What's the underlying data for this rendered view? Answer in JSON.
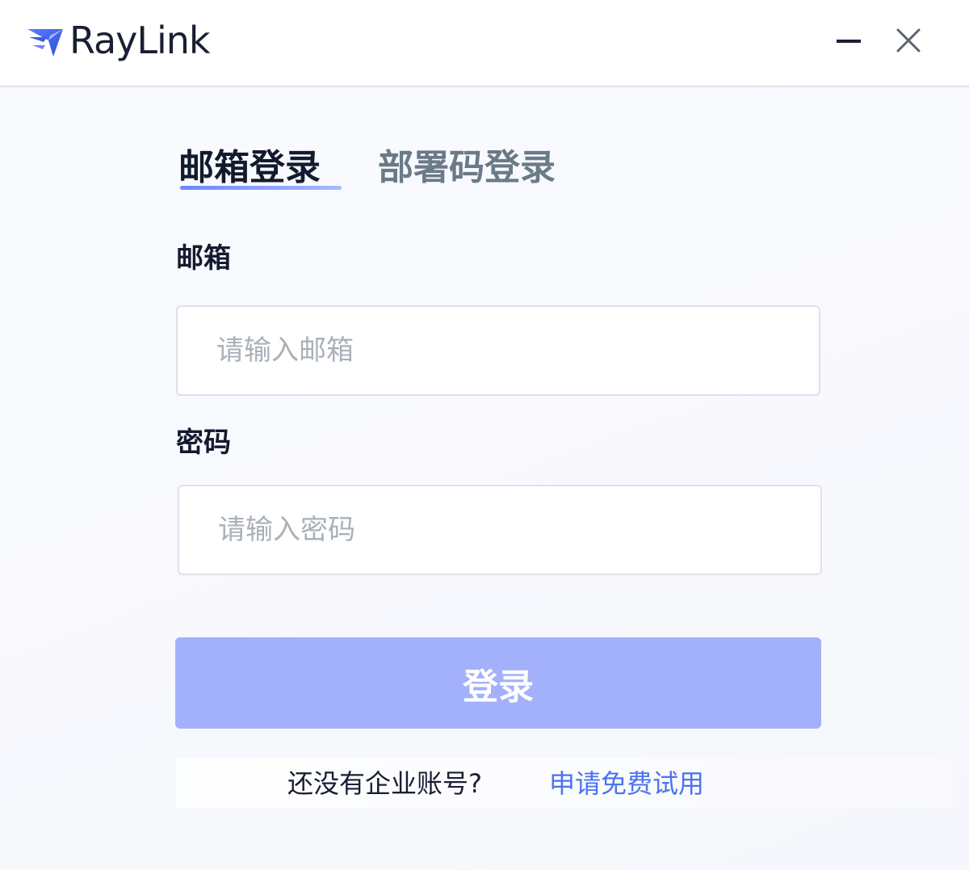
{
  "app": {
    "name": "RayLink",
    "logo_icon": "raylink-arrow-icon",
    "brand_color": "#3f63f0"
  },
  "window_controls": {
    "minimize_icon": "minimize-icon",
    "close_icon": "close-icon"
  },
  "tabs": [
    {
      "label": "邮箱登录",
      "active": true
    },
    {
      "label": "部署码登录",
      "active": false
    }
  ],
  "form": {
    "email_label": "邮箱",
    "email_placeholder": "请输入邮箱",
    "email_value": "",
    "password_label": "密码",
    "password_placeholder": "请输入密码",
    "password_value": "",
    "submit_label": "登录",
    "submit_color": "#a3b0fb"
  },
  "signup": {
    "prompt": "还没有企业账号?",
    "link_label": "申请免费试用",
    "link_color": "#4a73ee"
  }
}
